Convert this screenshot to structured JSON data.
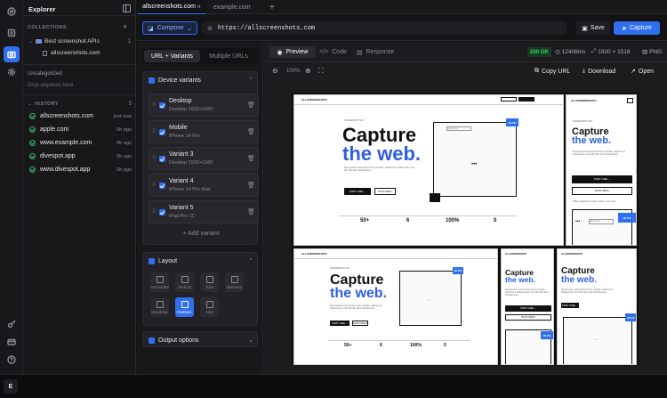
{
  "explorer": {
    "title": "Explorer",
    "collections_label": "COLLECTIONS",
    "collection_name": "Best screenshot APIs",
    "collection_count": "1",
    "collection_item": "allscreenshots.com",
    "uncategorized": "Uncategorized",
    "drop_hint": "Drop requests here",
    "history_label": "HISTORY",
    "history_count": "5",
    "history": [
      {
        "name": "allscreenshots.com",
        "time": "just now"
      },
      {
        "name": "apple.com",
        "time": "9h ago"
      },
      {
        "name": "www.example.com",
        "time": "9h ago"
      },
      {
        "name": "divespot.app",
        "time": "9h ago"
      },
      {
        "name": "www.divespot.app",
        "time": "9h ago"
      }
    ]
  },
  "tabs": [
    {
      "label": "allscreenshots.com"
    },
    {
      "label": "example.com"
    }
  ],
  "url": {
    "mode": "Compose",
    "value": "https://allscreenshots.com",
    "save": "Save",
    "capture": "Capture"
  },
  "left": {
    "tab_a": "URL + Variants",
    "tab_b": "Multiple URLs",
    "devices_title": "Device variants",
    "devices": [
      {
        "name": "Desktop",
        "spec": "Desktop 1920×1080"
      },
      {
        "name": "Mobile",
        "spec": "iPhone 14 Pro"
      },
      {
        "name": "Variant 3",
        "spec": "Desktop 1920×1080"
      },
      {
        "name": "Variant 4",
        "spec": "iPhone 14 Pro Max"
      },
      {
        "name": "Variant 5",
        "spec": "iPad Pro 11\""
      }
    ],
    "add_variant": "+ Add variant",
    "layout_title": "Layout",
    "layouts": [
      "Horizontal",
      "Vertical",
      "Grid",
      "Masonry",
      "Mondrian",
      "Partition",
      "Auto"
    ],
    "output_title": "Output options"
  },
  "main": {
    "tab_preview": "Preview",
    "tab_code": "Code",
    "tab_response": "Response",
    "status": "200 OK",
    "time": "12408ms",
    "size": "1920 × 1518",
    "format": "PNG",
    "zoom": "100%",
    "copy_url": "Copy URL",
    "download": "Download",
    "open": "Open"
  },
  "site": {
    "brand": "ALLSCREENSHOTS",
    "head1": "Capture",
    "head2": "the web.",
    "sub": "Pixel-perfect screenshots of any website, delivered in milliseconds. One API call. Zero infrastructure.",
    "start": "START FREE →",
    "docs": "BOOK DEMO",
    "badge": "99.5%",
    "url_chip": "github.com",
    "stat1": "50+",
    "stat2": "6",
    "stat3": "100%",
    "stat4": "0",
    "tag": "SCREENSHOT API",
    "foot": "SDKs available for Node, Python, and more"
  },
  "bottom": {
    "avatar": "E"
  }
}
